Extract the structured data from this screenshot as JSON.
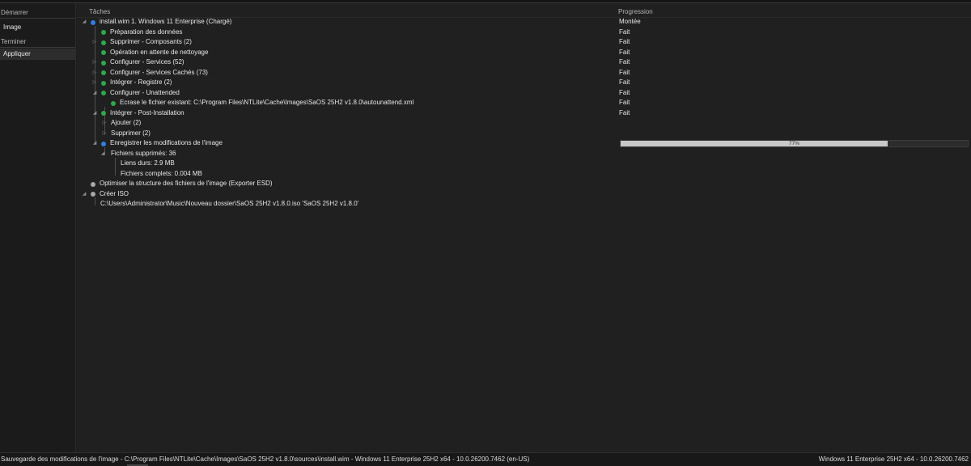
{
  "sidebar": {
    "sections": [
      {
        "header": "Démarrer",
        "items": [
          "Image"
        ]
      },
      {
        "header": "Terminer",
        "items": [
          "Appliquer"
        ]
      }
    ]
  },
  "columns": {
    "tasks": "Tâches",
    "progress": "Progression"
  },
  "tasks": [
    {
      "label": "install.wim 1. Windows 11 Enterprise  (Chargé)",
      "status": "Montée",
      "dot": "blue"
    },
    {
      "label": "Préparation des données",
      "status": "Fait",
      "dot": "green"
    },
    {
      "label": "Supprimer - Composants (2)",
      "status": "Fait",
      "dot": "green"
    },
    {
      "label": "Opération en attente de nettoyage",
      "status": "Fait",
      "dot": "green"
    },
    {
      "label": "Configurer - Services (52)",
      "status": "Fait",
      "dot": "green"
    },
    {
      "label": "Configurer - Services Cachés (73)",
      "status": "Fait",
      "dot": "green"
    },
    {
      "label": "Intégrer - Registre (2)",
      "status": "Fait",
      "dot": "green"
    },
    {
      "label": "Configurer - Unattended",
      "status": "Fait",
      "dot": "green"
    },
    {
      "label": "Ecrase le fichier existant: C:\\Program Files\\NTLite\\Cache\\Images\\SaOS 25H2 v1.8.0\\autounattend.xml",
      "status": "Fait",
      "dot": "green"
    },
    {
      "label": "Intégrer - Post-Installation",
      "status": "Fait",
      "dot": "green"
    },
    {
      "label": "Ajouter (2)",
      "status": "",
      "dot": ""
    },
    {
      "label": "Supprimer (2)",
      "status": "",
      "dot": ""
    },
    {
      "label": "Enregistrer les modifications de l'image",
      "status": "",
      "dot": "blue"
    },
    {
      "label": "Fichiers supprimés: 36",
      "status": "",
      "dot": ""
    },
    {
      "label": "Liens durs: 2.9 MB",
      "status": "",
      "dot": ""
    },
    {
      "label": "Fichiers complets: 0.004 MB",
      "status": "",
      "dot": ""
    },
    {
      "label": "Optimiser la structure des fichiers de l'image (Exporter ESD)",
      "status": "",
      "dot": "grey"
    },
    {
      "label": "Créer ISO",
      "status": "",
      "dot": "grey"
    },
    {
      "label": "C:\\Users\\Administrator\\Music\\Nouveau dossier\\SaOS 25H2 v1.8.0.iso 'SaOS 25H2 v1.8.0'",
      "status": "",
      "dot": ""
    }
  ],
  "progress": {
    "value": 0.77,
    "label": "77%"
  },
  "statusbar": {
    "left": "Sauvegarde des modifications de l'image - C:\\Program Files\\NTLite\\Cache\\Images\\SaOS 25H2 v1.8.0\\sources\\install.wim - Windows 11 Enterprise 25H2 x64 - 10.0.26200.7462 (en-US)",
    "right": "Windows 11 Enterprise 25H2 x64 - 10.0.26200.7462"
  },
  "colors": {
    "blue_dot": "#2f7fe0",
    "green_dot": "#2fa84a",
    "grey_dot": "#a8a8a8",
    "progress_fill": "#c8c8c8"
  }
}
